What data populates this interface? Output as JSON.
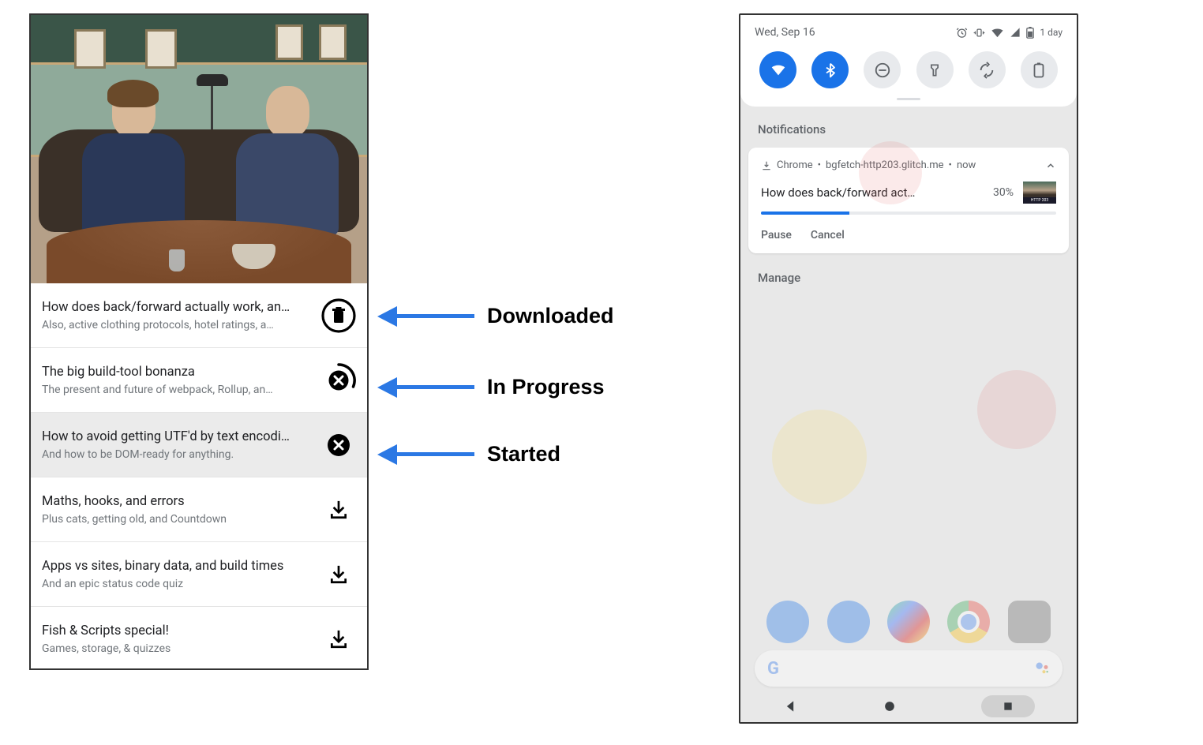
{
  "app_list": {
    "episodes": [
      {
        "title": "How does back/forward actually work, an…",
        "subtitle": "Also, active clothing protocols, hotel ratings, a…",
        "state": "downloaded"
      },
      {
        "title": "The big build-tool bonanza",
        "subtitle": "The present and future of webpack, Rollup, an…",
        "state": "in_progress"
      },
      {
        "title": "How to avoid getting UTF'd by text encodi…",
        "subtitle": "And how to be DOM-ready for anything.",
        "state": "started",
        "selected": true
      },
      {
        "title": "Maths, hooks, and errors",
        "subtitle": "Plus cats, getting old, and Countdown",
        "state": "idle"
      },
      {
        "title": "Apps vs sites, binary data, and build times",
        "subtitle": "And an epic status code quiz",
        "state": "idle"
      },
      {
        "title": "Fish & Scripts special!",
        "subtitle": "Games, storage, & quizzes",
        "state": "idle"
      }
    ]
  },
  "annotations": {
    "downloaded": "Downloaded",
    "in_progress": "In Progress",
    "started": "Started"
  },
  "android": {
    "date": "Wed, Sep 16",
    "battery_label": "1 day",
    "section_header": "Notifications",
    "notification": {
      "app": "Chrome",
      "source": "bgfetch-http203.glitch.me",
      "time": "now",
      "title": "How does back/forward act…",
      "percent": "30%",
      "progress": 30,
      "actions": {
        "pause": "Pause",
        "cancel": "Cancel"
      }
    },
    "manage": "Manage"
  }
}
